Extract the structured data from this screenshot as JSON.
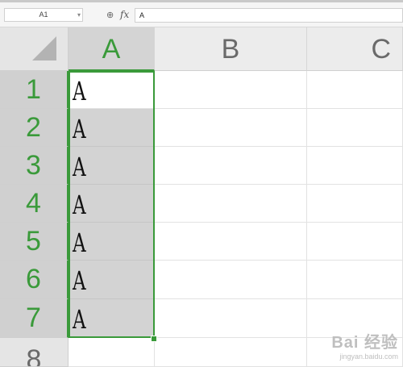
{
  "formula_bar": {
    "name_box": "A1",
    "name_box_arrow": "▾",
    "zoom_icon": "⊕",
    "fx_label": "fx",
    "formula_value": "A"
  },
  "columns": [
    "A",
    "B",
    "C"
  ],
  "rows": [
    "1",
    "2",
    "3",
    "4",
    "5",
    "6",
    "7",
    "8"
  ],
  "cells": {
    "A1": "A",
    "A2": "A",
    "A3": "A",
    "A4": "A",
    "A5": "A",
    "A6": "A",
    "A7": "A"
  },
  "colors": {
    "accent": "#3a9a3a",
    "selection_fill": "#d3d3d3",
    "header_bg": "#ececec"
  },
  "watermark": {
    "line1": "Bai 经验",
    "line2": "jingyan.baidu.com"
  }
}
